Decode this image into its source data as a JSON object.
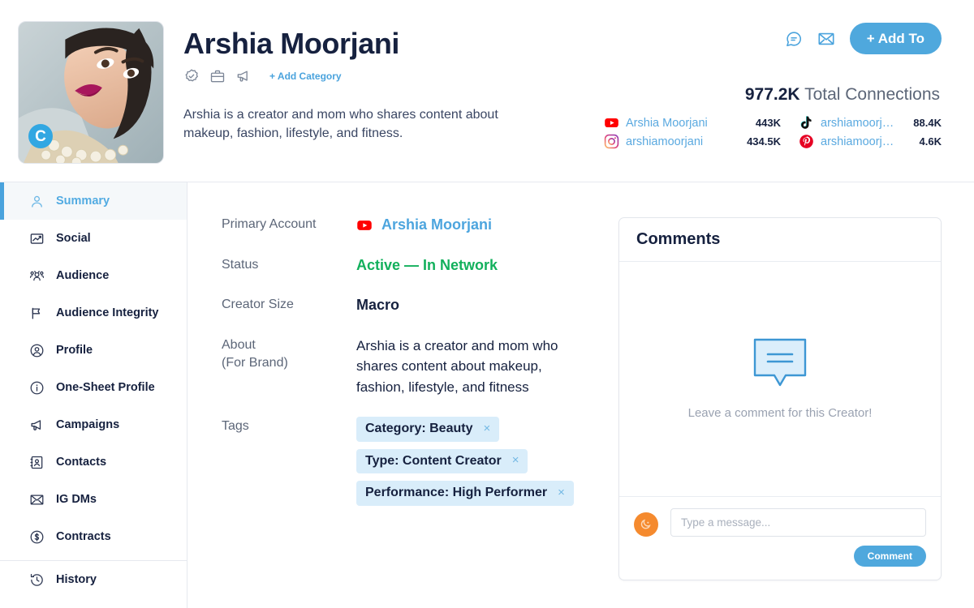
{
  "header": {
    "creator_name": "Arshia Moorjani",
    "avatar_badge_letter": "C",
    "badge_icons": [
      "verified-check-icon",
      "briefcase-icon",
      "megaphone-icon"
    ],
    "add_category_label": "+ Add Category",
    "bio": "Arshia is a creator and mom who shares content about makeup, fashion, lifestyle, and fitness.",
    "actions": {
      "comment_icon": "chat-bubble-icon",
      "mail_icon": "envelope-icon",
      "add_to_label": "+ Add To"
    },
    "connections": {
      "total_value": "977.2K",
      "total_label": "Total Connections",
      "accounts": [
        {
          "platform": "youtube",
          "handle": "Arshia Moorjani",
          "count": "443K"
        },
        {
          "platform": "tiktok",
          "handle": "arshiamoorjani",
          "count": "88.4K"
        },
        {
          "platform": "instagram",
          "handle": "arshiamoorjani",
          "count": "434.5K"
        },
        {
          "platform": "pinterest",
          "handle": "arshiamoorjani",
          "count": "4.6K"
        }
      ]
    }
  },
  "sidebar": {
    "items": [
      {
        "label": "Summary",
        "icon": "person-icon",
        "active": true
      },
      {
        "label": "Social",
        "icon": "chart-line-icon",
        "active": false
      },
      {
        "label": "Audience",
        "icon": "audience-icon",
        "active": false
      },
      {
        "label": "Audience Integrity",
        "icon": "flag-icon",
        "active": false
      },
      {
        "label": "Profile",
        "icon": "user-circle-icon",
        "active": false
      },
      {
        "label": "One-Sheet Profile",
        "icon": "info-circle-icon",
        "active": false
      },
      {
        "label": "Campaigns",
        "icon": "megaphone-icon",
        "active": false
      },
      {
        "label": "Contacts",
        "icon": "contact-card-icon",
        "active": false
      },
      {
        "label": "IG DMs",
        "icon": "envelope-icon",
        "active": false
      },
      {
        "label": "Contracts",
        "icon": "dollar-circle-icon",
        "active": false
      },
      {
        "label": "History",
        "icon": "history-clock-icon",
        "active": false
      }
    ]
  },
  "main": {
    "fields": {
      "primary_account_label": "Primary Account",
      "primary_account_value": "Arshia Moorjani",
      "primary_account_platform": "youtube",
      "status_label": "Status",
      "status_value": "Active — In Network",
      "creator_size_label": "Creator Size",
      "creator_size_value": "Macro",
      "about_label": "About",
      "about_sub_label": "(For Brand)",
      "about_value": "Arshia is a creator and mom who shares content about makeup, fashion, lifestyle, and fitness",
      "tags_label": "Tags"
    },
    "tags": [
      {
        "label": "Category: Beauty",
        "remove": "×"
      },
      {
        "label": "Type: Content Creator",
        "remove": "×"
      },
      {
        "label": "Performance: High Performer",
        "remove": "×"
      }
    ]
  },
  "comments": {
    "title": "Comments",
    "empty_text": "Leave a comment for this Creator!",
    "empty_icon": "speech-bubble-icon",
    "input_placeholder": "Type a message...",
    "input_value": "",
    "submit_label": "Comment"
  },
  "colors": {
    "accent_blue": "#4fa8dd",
    "link_blue": "#5aa9e0",
    "status_green": "#12b05c",
    "tag_bg": "#d9edfa",
    "text_dark": "#16213f",
    "text_muted": "#5c6678",
    "avatar_orange": "#f58a2e"
  }
}
